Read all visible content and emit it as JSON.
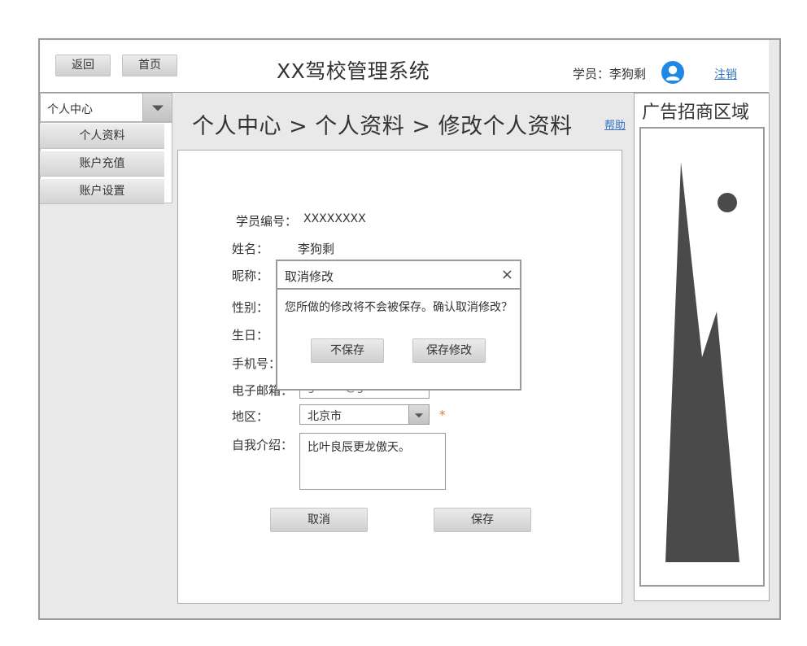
{
  "header": {
    "back_label": "返回",
    "home_label": "首页",
    "app_title": "XX驾校管理系统",
    "user_label": "学员：李狗剩",
    "avatar_icon": "user-avatar-icon",
    "logout_label": "注销"
  },
  "sidebar": {
    "selected": "个人中心",
    "items": [
      {
        "label": "个人资料"
      },
      {
        "label": "账户充值"
      },
      {
        "label": "账户设置"
      }
    ]
  },
  "breadcrumb": "个人中心 > 个人资料 > 修改个人资料",
  "help_label": "帮助",
  "form": {
    "student_id_label": "学员编号：",
    "student_id_value": "XXXXXXXX",
    "name_label": "姓名：",
    "name_value": "李狗剩",
    "nickname_label": "昵称：",
    "gender_label": "性别：",
    "birthday_label": "生日：",
    "phone_label": "手机号：",
    "email_label": "电子邮箱：",
    "email_value": "gusiee@gusiee.com",
    "region_label": "地区：",
    "region_value": "北京市",
    "required_mark": "*",
    "intro_label": "自我介绍：",
    "intro_value": "比叶良辰更龙傲天。",
    "cancel_label": "取消",
    "save_label": "保存"
  },
  "ad": {
    "title": "广告招商区域",
    "image_icon": "image-placeholder-icon"
  },
  "dialog": {
    "title": "取消修改",
    "close_icon": "close-icon",
    "close_glyph": "×",
    "message": "您所做的修改将不会被保存。确认取消修改？",
    "dont_save_label": "不保存",
    "save_label": "保存修改"
  },
  "colors": {
    "link": "#3572c2",
    "required": "#d07a3a",
    "avatar": "#1e88e5"
  }
}
